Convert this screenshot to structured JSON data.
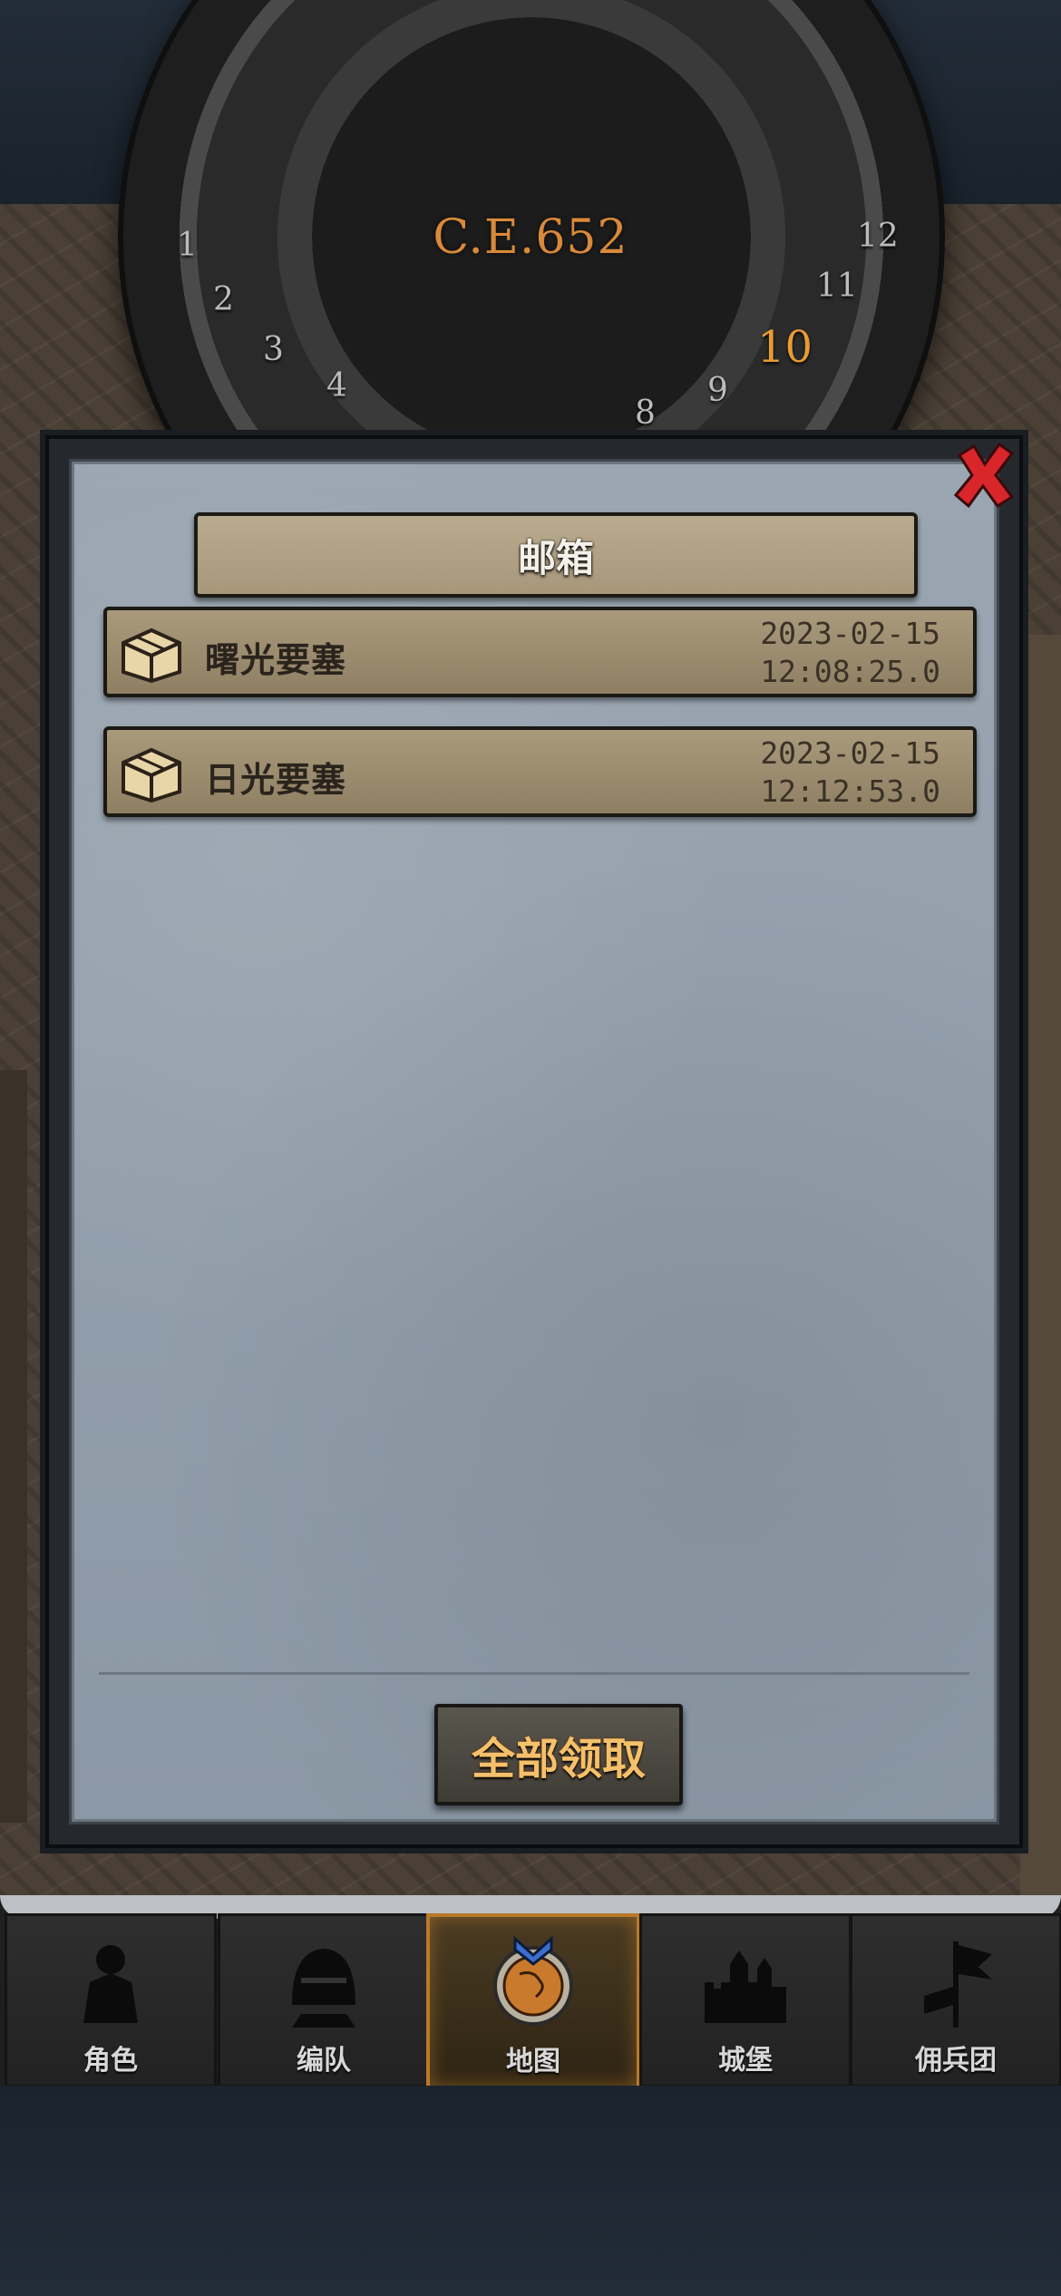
{
  "header": {
    "era": "C.E.652",
    "dial_numbers": [
      "1",
      "2",
      "3",
      "4",
      "8",
      "9",
      "10",
      "11",
      "12"
    ],
    "active_dial_number": "10"
  },
  "dialog": {
    "title": "邮箱",
    "mails": [
      {
        "sender": "曙光要塞",
        "date": "2023-02-15",
        "time": "12:08:25.0"
      },
      {
        "sender": "日光要塞",
        "date": "2023-02-15",
        "time": "12:12:53.0"
      }
    ],
    "claim_all_label": "全部领取"
  },
  "nav": {
    "items": [
      {
        "label": "角色",
        "icon": "knight-icon"
      },
      {
        "label": "编队",
        "icon": "helmet-icon"
      },
      {
        "label": "地图",
        "icon": "globe-icon",
        "active": true
      },
      {
        "label": "城堡",
        "icon": "castle-icon"
      },
      {
        "label": "佣兵团",
        "icon": "banner-icon"
      }
    ]
  },
  "colors": {
    "accent_orange": "#d9893a",
    "close_red": "#d8262a",
    "claim_text": "#f4c06a"
  }
}
